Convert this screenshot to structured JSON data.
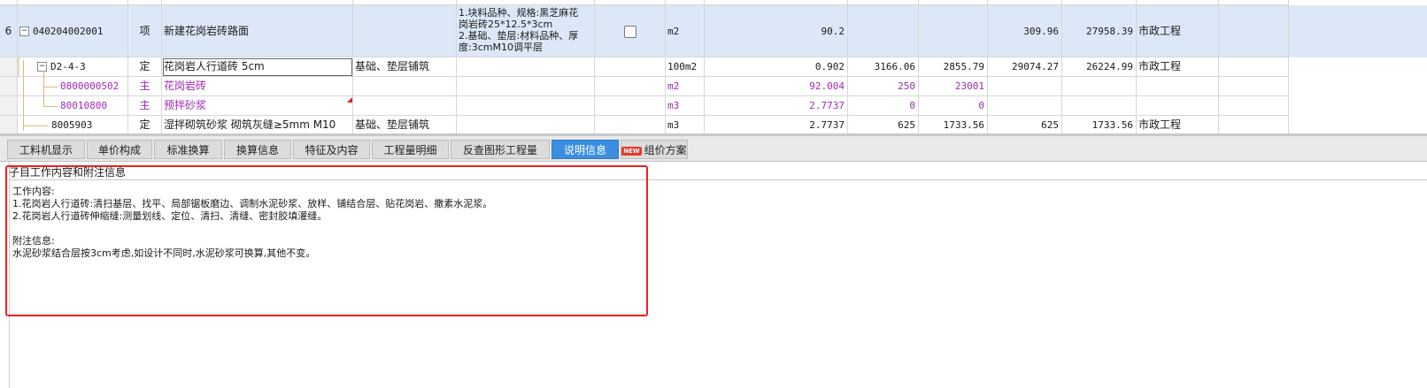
{
  "grid": {
    "rows": [
      {
        "row_no": "6",
        "code": "040204002001",
        "type": "项",
        "name": "新建花岗岩砖路面",
        "category": "",
        "features": [
          "1.块料品种、规格:黑芝麻花",
          "岗岩砖25*12.5*3cm",
          "2.基础、垫层:材料品种、厚",
          "度:3cmM10调平层"
        ],
        "unit": "m2",
        "qty": "90.2",
        "price1": "",
        "price2": "",
        "price3": "309.96",
        "total": "27958.39",
        "discipline": "市政工程"
      },
      {
        "row_no": "",
        "code": "D2-4-3",
        "type": "定",
        "name": "花岗岩人行道砖 5cm",
        "category": "基础、垫层铺筑",
        "unit": "100m2",
        "qty": "0.902",
        "price1": "3166.06",
        "price2": "2855.79",
        "price3": "29074.27",
        "total": "26224.99",
        "discipline": "市政工程"
      },
      {
        "row_no": "",
        "code": "0800000502",
        "type": "主",
        "name": "花岗岩砖",
        "category": "",
        "unit": "m2",
        "qty": "92.004",
        "price1": "250",
        "price2": "23001",
        "price3": "",
        "total": "",
        "discipline": ""
      },
      {
        "row_no": "",
        "code": "80010800",
        "type": "主",
        "name": "预拌砂浆",
        "category": "",
        "unit": "m3",
        "qty": "2.7737",
        "price1": "0",
        "price2": "0",
        "price3": "",
        "total": "",
        "discipline": ""
      },
      {
        "row_no": "",
        "code": "8005903",
        "type": "定",
        "name": "湿拌砌筑砂浆 砌筑灰缝≥5mm M10",
        "category": "基础、垫层铺筑",
        "unit": "m3",
        "qty": "2.7737",
        "price1": "625",
        "price2": "1733.56",
        "price3": "625",
        "total": "1733.56",
        "discipline": "市政工程"
      }
    ]
  },
  "tabs": [
    {
      "label": "工料机显示"
    },
    {
      "label": "单价构成"
    },
    {
      "label": "标准换算"
    },
    {
      "label": "换算信息"
    },
    {
      "label": "特征及内容"
    },
    {
      "label": "工程量明细"
    },
    {
      "label": "反查图形工程量"
    },
    {
      "label": "说明信息",
      "active": true
    },
    {
      "label": "组价方案",
      "badge": "NEW"
    }
  ],
  "panel": {
    "title": "子目工作内容和附注信息",
    "body": "工作内容:\n1.花岗岩人行道砖:清扫基层、找平、局部锯板磨边、调制水泥砂浆、放样、铺结合层、贴花岗岩、撒素水泥浆。\n2.花岗岩人行道砖伸缩缝:测量划线、定位、清扫、清缝、密封胶填灌缝。\n\n附注信息:\n水泥砂浆结合层按3cm考虑,如设计不同时,水泥砂浆可换算,其他不变。"
  },
  "colors": {
    "active_tab": "#3c8fe0",
    "highlight_row": "#dce8f7",
    "frame": "#ee2020",
    "material_text": "#a02ab4"
  }
}
